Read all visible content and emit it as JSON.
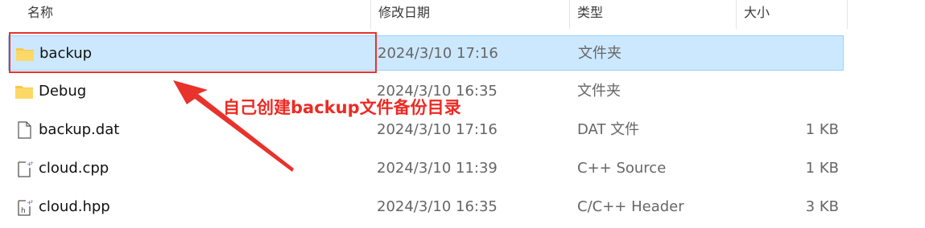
{
  "columns": {
    "name": "名称",
    "date_modified": "修改日期",
    "type": "类型",
    "size": "大小"
  },
  "files": [
    {
      "name": "backup",
      "date": "2024/3/10 17:16",
      "type": "文件夹",
      "size": "",
      "icon": "folder-icon",
      "selected": true
    },
    {
      "name": "Debug",
      "date": "2024/3/10 16:35",
      "type": "文件夹",
      "size": "",
      "icon": "folder-icon",
      "selected": false
    },
    {
      "name": "backup.dat",
      "date": "2024/3/10 17:16",
      "type": "DAT 文件",
      "size": "1 KB",
      "icon": "file-icon",
      "selected": false
    },
    {
      "name": "cloud.cpp",
      "date": "2024/3/10 11:39",
      "type": "C++ Source",
      "size": "1 KB",
      "icon": "cpp-file-icon",
      "selected": false
    },
    {
      "name": "cloud.hpp",
      "date": "2024/3/10 16:35",
      "type": "C/C++ Header",
      "size": "3 KB",
      "icon": "hpp-file-icon",
      "selected": false
    }
  ],
  "annotation": {
    "text": "自己创建backup文件备份目录",
    "color": "#e8322c"
  },
  "colors": {
    "selection_bg": "#cce8ff",
    "selection_border": "#99d1ff",
    "folder": "#f8c94a"
  }
}
